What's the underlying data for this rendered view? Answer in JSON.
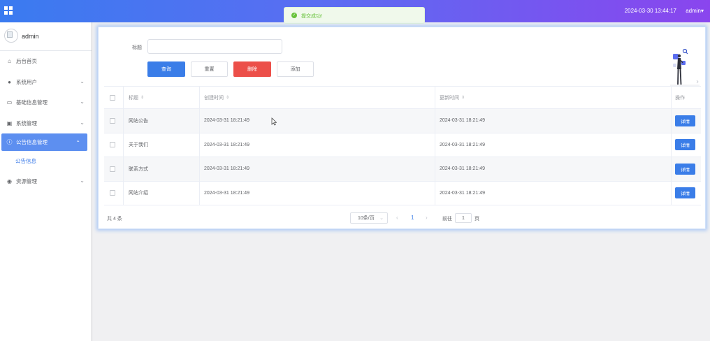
{
  "topbar": {
    "datetime": "2024-03-30 13:44:17",
    "user": "admin",
    "user_caret": "▾",
    "gradient_start": "#3a7bf0",
    "gradient_end": "#8a45ee"
  },
  "toast": {
    "icon": "check-circle-icon",
    "message": "提交成功!",
    "color": "#67c23a"
  },
  "sidebar": {
    "profile_name": "admin",
    "items": [
      {
        "label": "后台首页",
        "icon": "home-icon",
        "has_arrow": false
      },
      {
        "label": "系统用户",
        "icon": "user-icon",
        "has_arrow": true
      },
      {
        "label": "基础信息管理",
        "icon": "document-icon",
        "has_arrow": true
      },
      {
        "label": "系统管理",
        "icon": "image-icon",
        "has_arrow": true
      },
      {
        "label": "公告信息管理",
        "icon": "info-icon",
        "has_arrow": true,
        "active": true
      },
      {
        "label": "资源管理",
        "icon": "location-icon",
        "has_arrow": true
      }
    ],
    "submenu": [
      "公告信息"
    ],
    "active_color": "#5d8ff0"
  },
  "search": {
    "label": "标题",
    "value": "",
    "placeholder": ""
  },
  "buttons": {
    "query": "查询",
    "reset": "重置",
    "delete": "删除",
    "add": "添加"
  },
  "table": {
    "columns": [
      "标题",
      "创建时间",
      "更新时间",
      "操作"
    ],
    "rows": [
      {
        "title": "网站公告",
        "created": "2024-03-31 18:21:49",
        "updated": "2024-03-31 18:21:49",
        "action": "详情"
      },
      {
        "title": "关于我们",
        "created": "2024-03-31 18:21:49",
        "updated": "2024-03-31 18:21:49",
        "action": "详情"
      },
      {
        "title": "联系方式",
        "created": "2024-03-31 18:21:49",
        "updated": "2024-03-31 18:21:49",
        "action": "详情"
      },
      {
        "title": "网站介绍",
        "created": "2024-03-31 18:21:49",
        "updated": "2024-03-31 18:21:49",
        "action": "详情"
      }
    ]
  },
  "pagination": {
    "total": "共 4 条",
    "page_size": "10条/页",
    "current_page": "1",
    "goto_label": "前往",
    "goto_value": "1",
    "goto_unit": "页"
  }
}
